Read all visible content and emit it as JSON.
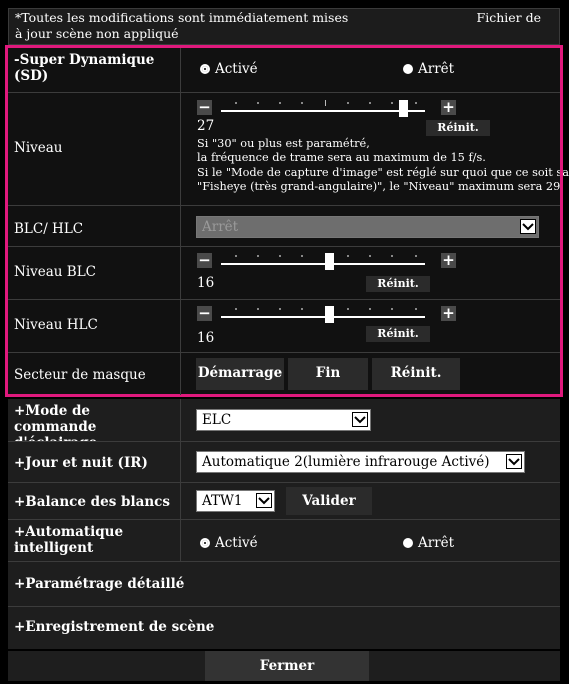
{
  "notice": {
    "text": "*Toutes les modifications sont immédiatement mises à jour scène non appliqué",
    "right": "Fichier de"
  },
  "super_dynamique": {
    "label": "-Super Dynamique (SD)",
    "opt_on": "Activé",
    "opt_off": "Arrêt",
    "selected": "Activé"
  },
  "niveau": {
    "label": "Niveau",
    "value": "27",
    "reset": "Réinit.",
    "minus_icon": "minus",
    "plus_icon": "plus",
    "note1": "Si \"30\" ou plus est paramétré,",
    "note2": "la fréquence de trame sera au maximum de 15 f/s.",
    "note3": "Si le \"Mode de capture d'image\" est réglé sur quoi que ce soit sauf",
    "note4": "\"Fisheye (très grand-angulaire)\", le \"Niveau\" maximum sera 29."
  },
  "blc_hlc": {
    "label": "BLC/ HLC",
    "value": "Arrêt"
  },
  "niveau_blc": {
    "label": "Niveau BLC",
    "value": "16",
    "reset": "Réinit."
  },
  "niveau_hlc": {
    "label": "Niveau HLC",
    "value": "16",
    "reset": "Réinit."
  },
  "secteur": {
    "label": "Secteur de masque",
    "start": "Démarrage",
    "end": "Fin",
    "reset": "Réinit."
  },
  "eclairage": {
    "label": "+Mode de commande d'éclairage",
    "value": "ELC"
  },
  "jour_nuit": {
    "label": "+Jour et nuit (IR)",
    "value": "Automatique 2(lumière infrarouge Activé)"
  },
  "balance": {
    "label": "+Balance des blancs",
    "value": "ATW1",
    "validate": "Valider"
  },
  "auto_intel": {
    "label": "+Automatique intelligent",
    "opt_on": "Activé",
    "opt_off": "Arrêt",
    "selected": "Activé"
  },
  "param_detail": {
    "label": "+Paramétrage détaillé"
  },
  "enregistrement": {
    "label": "+Enregistrement de scène"
  },
  "close_label": "Fermer",
  "accent_color": "#e0197d"
}
